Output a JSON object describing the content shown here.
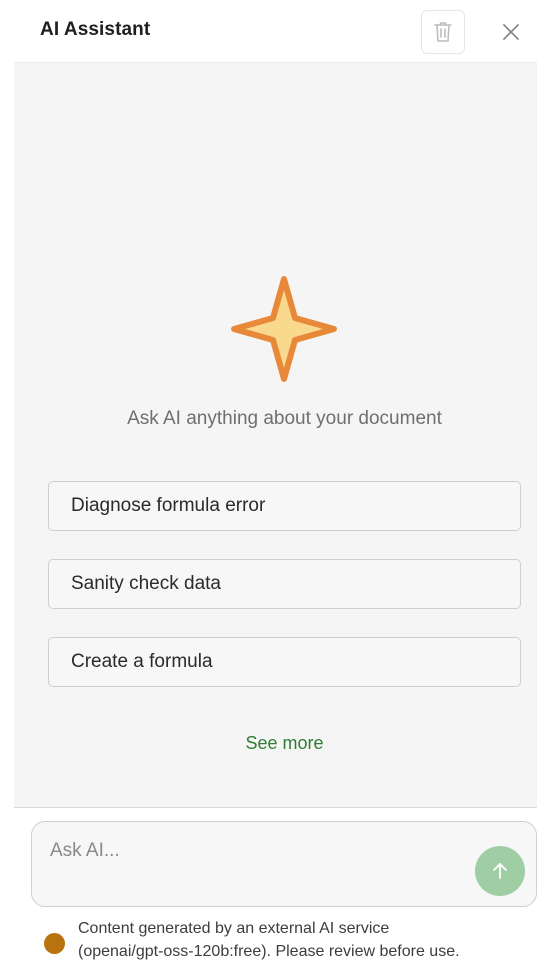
{
  "header": {
    "title": "AI Assistant",
    "delete_icon": "trash-icon",
    "close_icon": "close-icon"
  },
  "main": {
    "icon": "sparkle-icon",
    "hint": "Ask AI anything about your document",
    "suggestions": [
      {
        "label": "Diagnose formula error"
      },
      {
        "label": "Sanity check data"
      },
      {
        "label": "Create a formula"
      }
    ],
    "see_more": "See more"
  },
  "input": {
    "placeholder": "Ask AI...",
    "value": "",
    "send_icon": "arrow-up-icon"
  },
  "footer": {
    "line1": "Content generated by an external AI service",
    "line2": "(openai/gpt-oss-120b:free). Please review before use."
  },
  "colors": {
    "accent_green": "#2e7d32",
    "send_button": "#9fcea5",
    "sparkle_fill": "#f8d98e",
    "sparkle_stroke": "#e8893a",
    "status_dot": "#b8730f"
  }
}
